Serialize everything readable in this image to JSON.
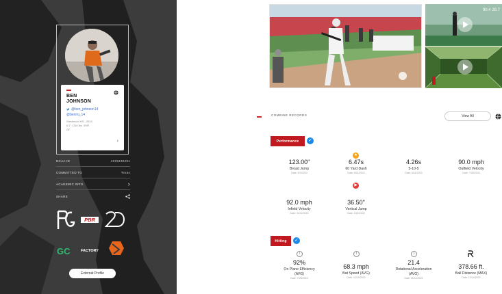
{
  "profile": {
    "name_line1": "BEN",
    "name_line2": "JOHNSON",
    "twitter": "@ben_johnson14",
    "instagram": "@benmj_14",
    "meta_line1": "Westwood HS - 2024",
    "meta_line2": "6'1\" / 210 lbs / R/R",
    "meta_line3": "OF"
  },
  "info_rows": [
    {
      "label": "NCAA ID",
      "value": "2009430291"
    },
    {
      "label": "COMMITTED TO",
      "value": "Texas"
    },
    {
      "label": "ACADEMIC INFO",
      "value": ""
    },
    {
      "label": "SHARE",
      "value": ""
    }
  ],
  "logos": [
    "PG",
    "PBR",
    "2D",
    "GC",
    "FACTORY"
  ],
  "external_profile_label": "External Profile",
  "videos": {
    "thumb1_overlay": "90.4 28.7"
  },
  "combine": {
    "title": "COMBINE RECORDS",
    "view_all": "View All",
    "performance_label": "Performance",
    "hitting_label": "Hitting",
    "performance": [
      {
        "value": "123.00\"",
        "label": "Broad Jump",
        "date": "Date: 6/3/2023"
      },
      {
        "value": "6.47s",
        "label": "60 Yard Dash",
        "date": "Date: 6/11/2023"
      },
      {
        "value": "4.26s",
        "label": "5-10-5",
        "date": "Date: 6/11/2023"
      },
      {
        "value": "90.0 mph",
        "label": "Outfield Velocity",
        "date": "Date: 7/28/2020"
      },
      {
        "value": "92.0 mph",
        "label": "Infield Velocity",
        "date": "Date: 11/11/2020"
      },
      {
        "value": "36.50\"",
        "label": "Vertical Jump",
        "date": "Date: 2/22/2022"
      }
    ],
    "hitting": [
      {
        "value": "92%",
        "label": "On Plane Efficiency",
        "label2": "(AVG)",
        "date": "Date: 7/28/2020"
      },
      {
        "value": "68.3 mph",
        "label": "Bat Speed (AVG)",
        "label2": "",
        "date": "Date: 11/14/2022"
      },
      {
        "value": "21.4",
        "label": "Rotational Acceleration",
        "label2": "(AVG)",
        "date": "Date: 11/14/2022"
      },
      {
        "value": "378.66 ft.",
        "label": "Ball Distance (MAX)",
        "label2": "",
        "date": "Date: 11/14/2022"
      }
    ]
  },
  "colors": {
    "accent_red": "#c0191f",
    "verified_blue": "#1e88e5",
    "badge_orange": "#f6a313",
    "badge_red": "#e53935"
  }
}
